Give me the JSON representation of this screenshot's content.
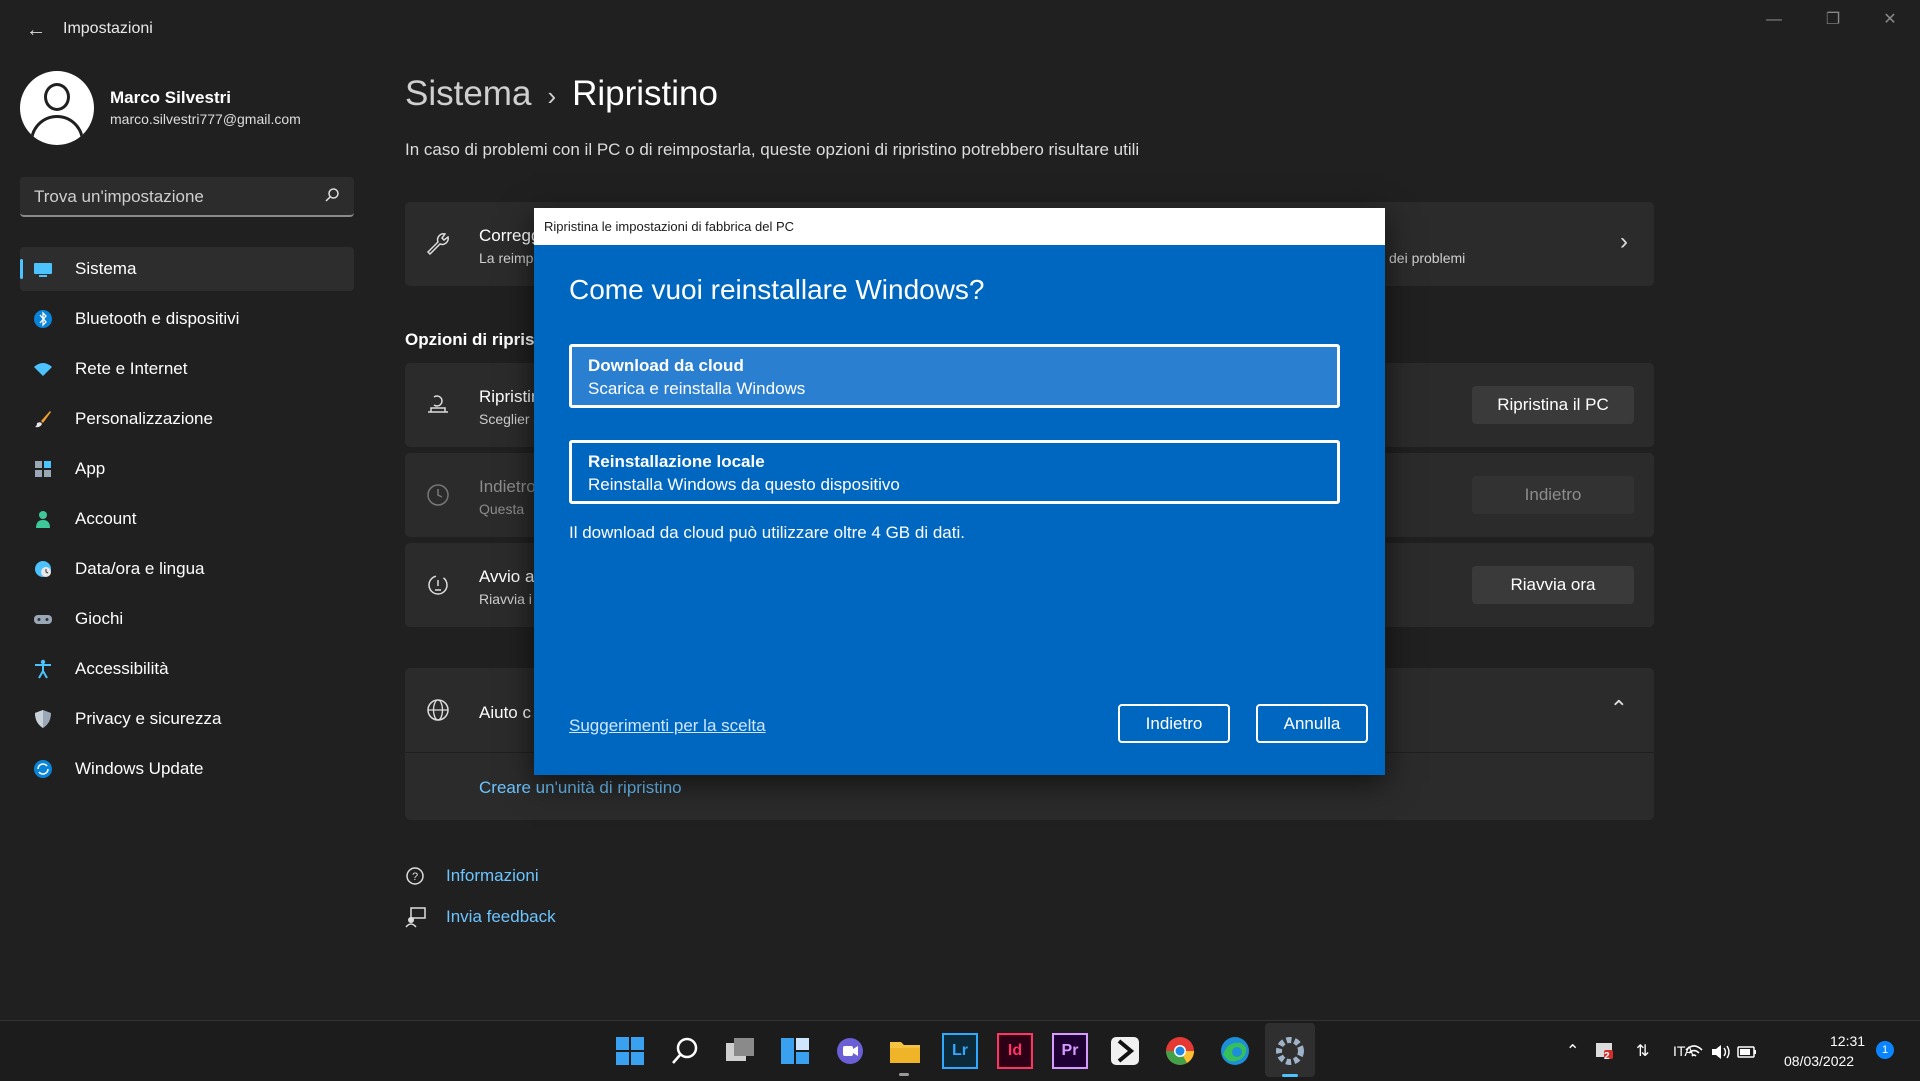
{
  "window": {
    "title": "Impostazioni"
  },
  "profile": {
    "name": "Marco Silvestri",
    "email": "marco.silvestri777@gmail.com"
  },
  "search": {
    "placeholder": "Trova un'impostazione"
  },
  "sidebar": {
    "items": [
      {
        "label": "Sistema",
        "icon": "monitor-icon",
        "selected": true
      },
      {
        "label": "Bluetooth e dispositivi",
        "icon": "bluetooth-icon"
      },
      {
        "label": "Rete e Internet",
        "icon": "wifi-icon"
      },
      {
        "label": "Personalizzazione",
        "icon": "brush-icon"
      },
      {
        "label": "App",
        "icon": "apps-icon"
      },
      {
        "label": "Account",
        "icon": "person-icon"
      },
      {
        "label": "Data/ora e lingua",
        "icon": "globe-clock-icon"
      },
      {
        "label": "Giochi",
        "icon": "gamepad-icon"
      },
      {
        "label": "Accessibilità",
        "icon": "accessibility-icon"
      },
      {
        "label": "Privacy e sicurezza",
        "icon": "shield-icon"
      },
      {
        "label": "Windows Update",
        "icon": "update-icon"
      }
    ]
  },
  "main": {
    "breadcrumb_parent": "Sistema",
    "breadcrumb_sep": "›",
    "breadcrumb_current": "Ripristino",
    "subtitle": "In caso di problemi con il PC o di reimpostarla, queste opzioni di ripristino potrebbero risultare utili",
    "card_fix": {
      "title": "Corregg",
      "subtitle": "La reimp",
      "right_text": "dei problemi"
    },
    "section_label": "Opzioni di riprist",
    "card_reset": {
      "title": "Ripristin",
      "subtitle": "Sceglier",
      "button": "Ripristina il PC"
    },
    "card_back": {
      "title": "Indietro",
      "subtitle": "Questa",
      "button": "Indietro"
    },
    "card_adv": {
      "title": "Avvio a",
      "subtitle": "Riavvia i",
      "button": "Riavvia ora"
    },
    "card_help": {
      "title": "Aiuto c",
      "link": "Creare un'unità di ripristino"
    },
    "footer_links": {
      "info": "Informazioni",
      "feedback": "Invia feedback"
    }
  },
  "dialog": {
    "title": "Ripristina le impostazioni di fabbrica del PC",
    "heading": "Come vuoi reinstallare Windows?",
    "options": [
      {
        "title": "Download da cloud",
        "subtitle": "Scarica e reinstalla Windows",
        "selected": true
      },
      {
        "title": "Reinstallazione locale",
        "subtitle": "Reinstalla Windows da questo dispositivo"
      }
    ],
    "note": "Il download da cloud può utilizzare oltre 4 GB di dati.",
    "help_link": "Suggerimenti per la scelta",
    "back_button": "Indietro",
    "cancel_button": "Annulla"
  },
  "taskbar": {
    "apps": [
      "windows-start-icon",
      "search-icon",
      "task-view-icon",
      "widgets-icon",
      "chat-icon",
      "file-explorer-icon",
      "lightroom-icon",
      "indesign-icon",
      "premiere-icon",
      "app-icon",
      "chrome-icon",
      "edge-icon",
      "settings-icon"
    ],
    "app_labels": {
      "lr": "Lr",
      "id": "Id",
      "pr": "Pr"
    },
    "tray": {
      "language": "ITA",
      "time": "12:31",
      "date": "08/03/2022",
      "badge": "2",
      "notifications": "1"
    }
  }
}
